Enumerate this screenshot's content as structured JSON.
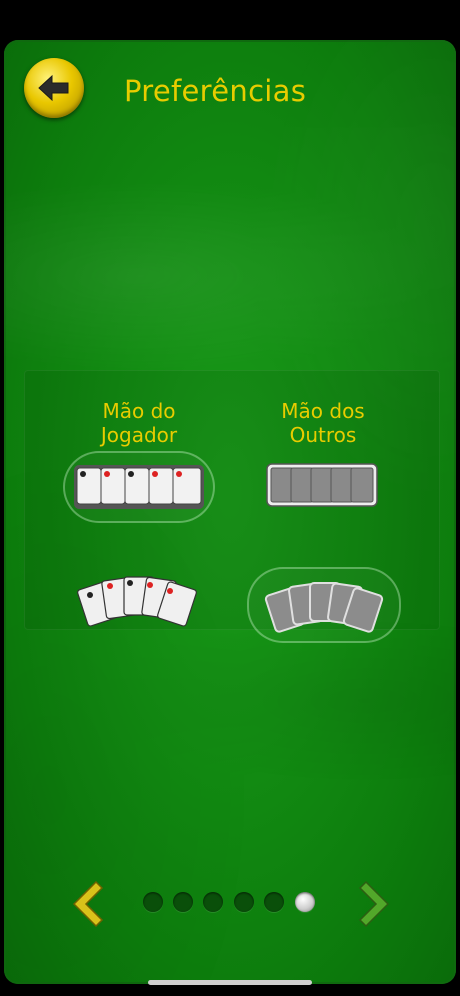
{
  "header": {
    "title": "Preferências",
    "back_icon": "arrow-left-icon"
  },
  "preferences": {
    "player_hand": {
      "title_line1": "Mão do",
      "title_line2": "Jogador",
      "options": [
        {
          "name": "straight-cards",
          "selected": true
        },
        {
          "name": "fanned-cards",
          "selected": false
        }
      ]
    },
    "others_hand": {
      "title_line1": "Mão dos",
      "title_line2": "Outros",
      "options": [
        {
          "name": "straight-card-backs",
          "selected": false
        },
        {
          "name": "fanned-card-backs",
          "selected": true
        }
      ]
    }
  },
  "pager": {
    "page_count": 6,
    "current_page": 6
  },
  "colors": {
    "accent_gold": "#e8cc00",
    "felt_green": "#138d13"
  }
}
